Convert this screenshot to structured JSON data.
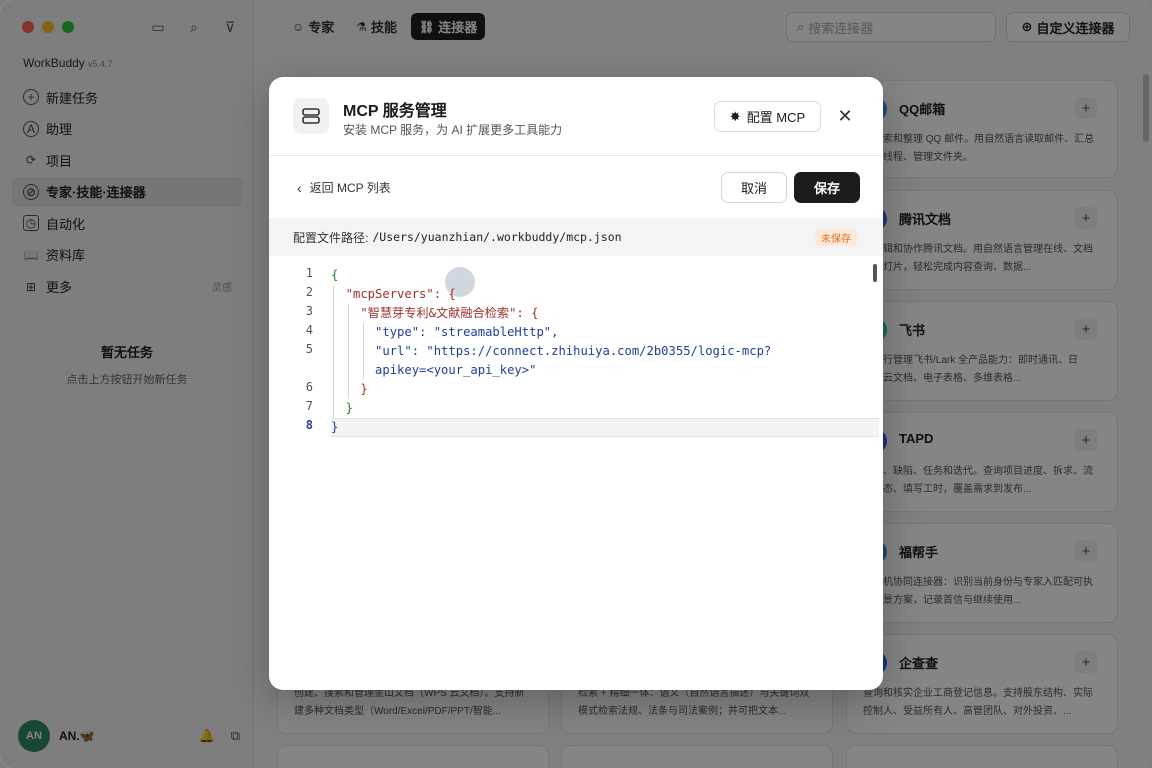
{
  "app": {
    "name": "WorkBuddy",
    "version": "v5.4.7"
  },
  "sidebar": {
    "items": [
      {
        "label": "新建任务",
        "icon": "plus-circle-icon"
      },
      {
        "label": "助理",
        "icon": "assistant-icon"
      },
      {
        "label": "项目",
        "icon": "project-icon"
      },
      {
        "label": "专家·技能·连接器",
        "icon": "connector-icon",
        "active": true
      },
      {
        "label": "自动化",
        "icon": "clock-icon"
      },
      {
        "label": "资料库",
        "icon": "book-icon"
      },
      {
        "label": "更多",
        "icon": "grid-icon",
        "extra": "灵感"
      }
    ],
    "empty_title": "暂无任务",
    "empty_hint": "点击上方按钮开始新任务",
    "user_name": "AN.🦋",
    "avatar_text": "AN"
  },
  "topbar": {
    "tabs": [
      {
        "label": "专家",
        "icon": "expert-icon"
      },
      {
        "label": "技能",
        "icon": "skill-icon"
      },
      {
        "label": "连接器",
        "icon": "link-icon",
        "active": true
      }
    ],
    "search_placeholder": "搜索连接器",
    "custom_button": "自定义连接器"
  },
  "cards": [
    {
      "title": "QQ邮箱",
      "desc": "、搜索和整理 QQ 邮件。用自然语言读取邮件、汇总邮件线程、管理文件夹。"
    },
    {
      "title": "腾讯文档",
      "desc": "、编辑和协作腾讯文档。用自然语言管理在线、文档和幻灯片，轻松完成内容查询、数据..."
    },
    {
      "title": "飞书",
      "desc": "命令行管理飞书/Lark 全产品能力：即时通讯、日历、云文档、电子表格、多维表格..."
    },
    {
      "title": "TAPD",
      "desc": "需求、缺陷、任务和迭代。查询项目进度、拆求、流转状态、填写工时，覆盖需求到发布..."
    },
    {
      "title": "福帮手",
      "desc": "手人机协同连接器：识别当前身份与专家入匹配可执行场景方案，记录首信与继续使用..."
    },
    {
      "title": "企查查",
      "desc": "查询和核实企业工商登记信息。支持股东结构、实际控制人、受益所有人、高管团队、对外投资、..."
    }
  ],
  "bottom_cards": [
    {
      "desc": "创建、搜索和管理金山文档（WPS 云文档）。支持新建多种文档类型（Word/Excel/PDF/PPT/智能..."
    },
    {
      "desc": "检索 + 精细一体：语义（自然语言描述）与关键词双模式检索法规、法条与司法案例；并可把文本..."
    }
  ],
  "modal": {
    "title": "MCP 服务管理",
    "subtitle": "安装 MCP 服务，为 AI 扩展更多工具能力",
    "config_button": "配置 MCP",
    "back_label": "返回 MCP 列表",
    "cancel": "取消",
    "save": "保存",
    "path_label": "配置文件路径:",
    "path_value": "/Users/yuanzhian/.workbuddy/mcp.json",
    "unsaved_badge": "未保存",
    "code_lines": [
      {
        "n": "1",
        "text": "{"
      },
      {
        "n": "2",
        "text": "  \"mcpServers\": {"
      },
      {
        "n": "3",
        "text": "    \"智慧芽专利&文献融合检索\": {"
      },
      {
        "n": "4",
        "text": "      \"type\": \"streamableHttp\","
      },
      {
        "n": "5",
        "text": "      \"url\": \"https://connect.zhihuiya.com/2b0355/logic-mcp?"
      },
      {
        "n": "",
        "text": "      apikey=<your_api_key>\""
      },
      {
        "n": "6",
        "text": "    }"
      },
      {
        "n": "7",
        "text": "  }"
      },
      {
        "n": "8",
        "text": "}"
      }
    ]
  }
}
